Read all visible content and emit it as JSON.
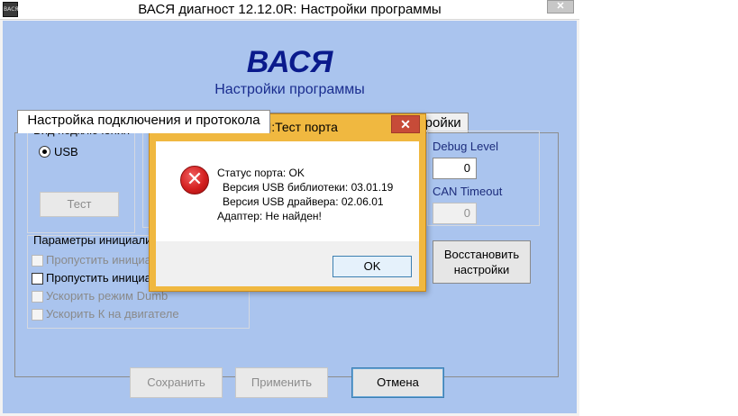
{
  "window": {
    "title": "ВАСЯ диагност 12.12.0R:  Настройки программы",
    "icon_text": "ВАСЯ",
    "close_glyph": "✕"
  },
  "app": {
    "logo": "ВАСЯ",
    "subtitle": "Настройки программы"
  },
  "tabs": [
    {
      "label": "Настройка подключения и протокола",
      "active": true
    },
    {
      "label": "Пользовательские настройки",
      "active": false
    }
  ],
  "connection": {
    "group_label": "Вид подключения",
    "option_label": "USB",
    "test_button": "Тест"
  },
  "params": {
    "group_label": "Параметры инициализ",
    "options": [
      {
        "label": "Пропустить инициал",
        "checked": false,
        "enabled": false
      },
      {
        "label": "Пропустить инициал",
        "checked": false,
        "enabled": true
      },
      {
        "label": "Ускорить режим Dumb",
        "checked": false,
        "enabled": false
      },
      {
        "label": "Ускорить К на двигателе",
        "checked": false,
        "enabled": false
      }
    ]
  },
  "debug": {
    "debug_level_label": "Debug Level",
    "debug_level_value": "0",
    "can_timeout_label": "CAN Timeout",
    "can_timeout_value": "0",
    "restore_line1": "Восстановить",
    "restore_line2": "настройки"
  },
  "bottom": {
    "save": "Сохранить",
    "apply": "Применить",
    "cancel": "Отмена"
  },
  "dialog": {
    "title": "ВАСЯ:Тест порта",
    "close_glyph": "✕",
    "icon": "error-icon",
    "lines": [
      "Статус порта: OK",
      "Версия USB библиотеки: 03.01.19",
      "Версия USB драйвера: 02.06.01",
      "Адаптер: Не найден!"
    ],
    "ok": "OK"
  },
  "colors": {
    "client_bg": "#aac4ee",
    "logo": "#0a1a8c",
    "dialog_frame": "#f0b840",
    "dialog_close": "#c74b38",
    "error_red": "#d42020"
  }
}
